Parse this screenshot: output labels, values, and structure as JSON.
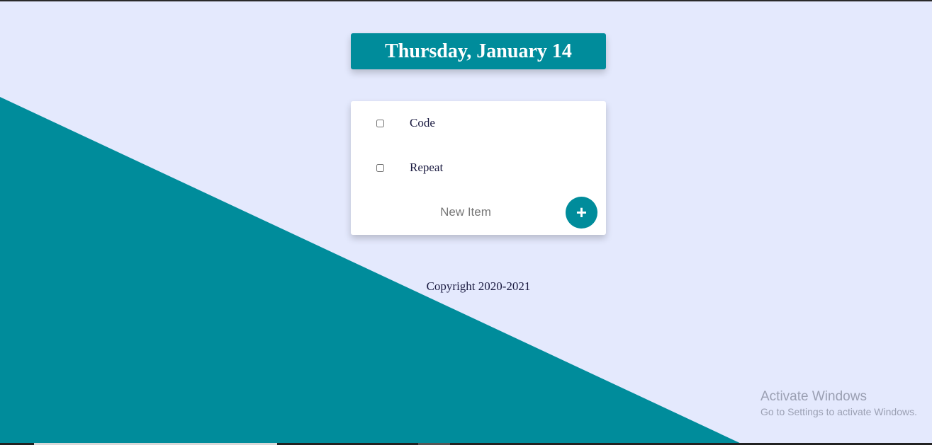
{
  "heading": {
    "date": "Thursday, January 14"
  },
  "todo": {
    "items": [
      {
        "label": "Code",
        "checked": false
      },
      {
        "label": "Repeat",
        "checked": false
      }
    ],
    "new_item_placeholder": "New Item",
    "add_button_label": "+"
  },
  "footer": {
    "copyright": "Copyright 2020-2021"
  },
  "watermark": {
    "title": "Activate Windows",
    "subtitle": "Go to Settings to activate Windows."
  },
  "colors": {
    "background": "#E4E9FD",
    "accent": "#008C9B",
    "card": "#FFFFFF",
    "text": "#1A1A40"
  },
  "icons": {
    "add": "plus-icon"
  }
}
